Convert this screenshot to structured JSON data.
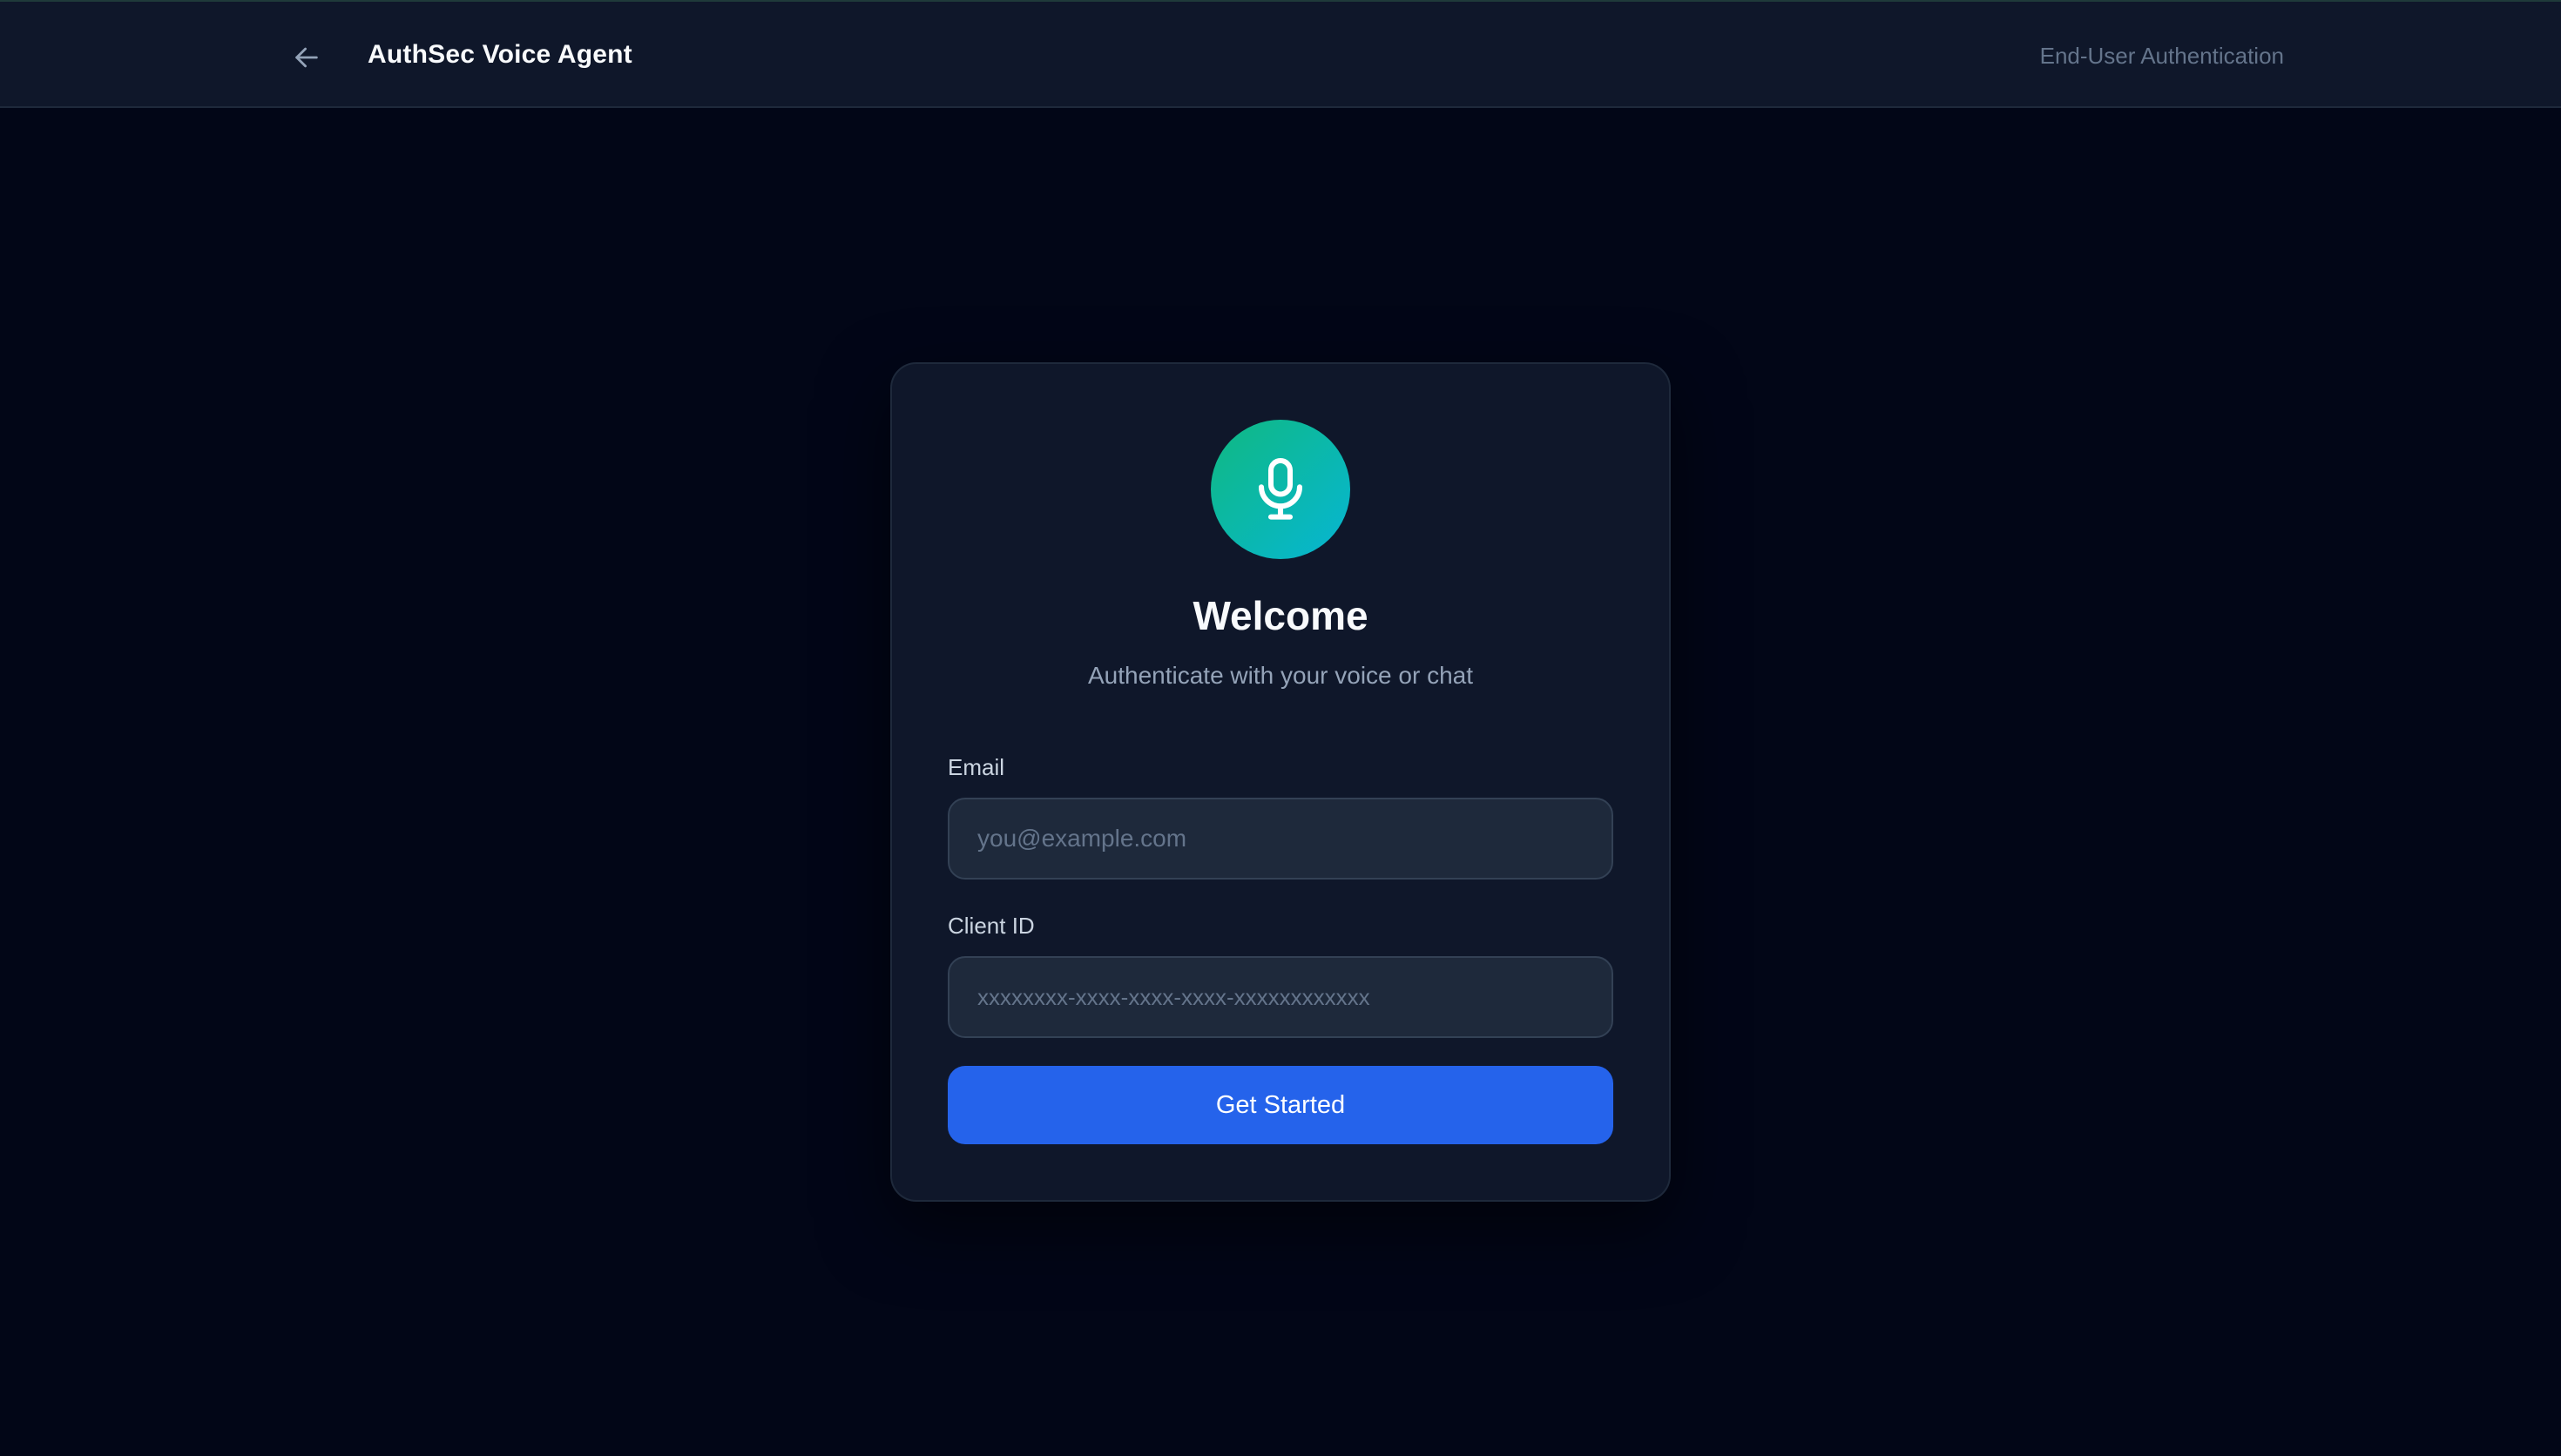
{
  "header": {
    "title": "AuthSec Voice Agent",
    "right_text": "End-User Authentication",
    "back_icon": "arrow-left-icon"
  },
  "card": {
    "icon": "microphone-icon",
    "title": "Welcome",
    "subtitle": "Authenticate with your voice or chat",
    "email": {
      "label": "Email",
      "value": "",
      "placeholder": "you@example.com"
    },
    "client_id": {
      "label": "Client ID",
      "value": "",
      "placeholder": "xxxxxxxx-xxxx-xxxx-xxxx-xxxxxxxxxxxx"
    },
    "submit_label": "Get Started"
  },
  "colors": {
    "background": "#020617",
    "surface": "#0f172a",
    "input_bg": "#1e293b",
    "accent": "#2563eb",
    "mic_gradient_start": "#10b981",
    "mic_gradient_end": "#06b6d4"
  }
}
